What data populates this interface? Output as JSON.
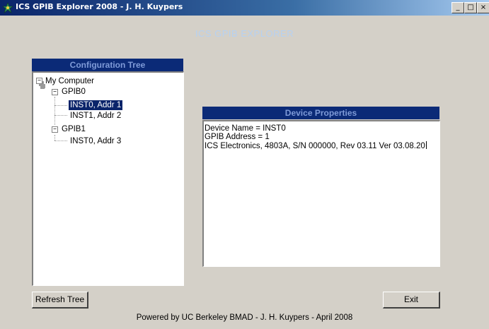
{
  "window": {
    "title": "ICS GPIB Explorer 2008 - J. H. Kuypers",
    "controls": {
      "minimize": "_",
      "maximize": "□",
      "close": "×"
    }
  },
  "app_header": "ICS GPIB EXPLORER",
  "config_tree": {
    "title": "Configuration Tree",
    "root": "My Computer",
    "nodes": [
      {
        "label": "GPIB0",
        "children": [
          "INST0, Addr 1",
          "INST1, Addr 2"
        ]
      },
      {
        "label": "GPIB1",
        "children": [
          "INST0, Addr 3"
        ]
      }
    ],
    "selected": "INST0, Addr 1"
  },
  "device_properties": {
    "title": "Device Properties",
    "lines": [
      "Device Name = INST0",
      "GPIB Address = 1",
      "ICS Electronics, 4803A, S/N 000000, Rev 03.11 Ver 03.08.20"
    ]
  },
  "buttons": {
    "refresh": "Refresh Tree",
    "exit": "Exit"
  },
  "footer": "Powered by UC Berkeley BMAD - J. H. Kuypers - April 2008"
}
